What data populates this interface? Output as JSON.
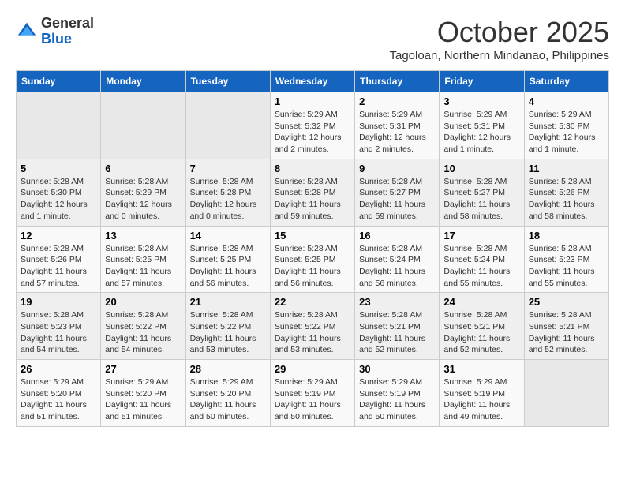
{
  "logo": {
    "general": "General",
    "blue": "Blue"
  },
  "title": "October 2025",
  "location": "Tagoloan, Northern Mindanao, Philippines",
  "headers": [
    "Sunday",
    "Monday",
    "Tuesday",
    "Wednesday",
    "Thursday",
    "Friday",
    "Saturday"
  ],
  "weeks": [
    [
      {
        "day": "",
        "info": ""
      },
      {
        "day": "",
        "info": ""
      },
      {
        "day": "",
        "info": ""
      },
      {
        "day": "1",
        "info": "Sunrise: 5:29 AM\nSunset: 5:32 PM\nDaylight: 12 hours\nand 2 minutes."
      },
      {
        "day": "2",
        "info": "Sunrise: 5:29 AM\nSunset: 5:31 PM\nDaylight: 12 hours\nand 2 minutes."
      },
      {
        "day": "3",
        "info": "Sunrise: 5:29 AM\nSunset: 5:31 PM\nDaylight: 12 hours\nand 1 minute."
      },
      {
        "day": "4",
        "info": "Sunrise: 5:29 AM\nSunset: 5:30 PM\nDaylight: 12 hours\nand 1 minute."
      }
    ],
    [
      {
        "day": "5",
        "info": "Sunrise: 5:28 AM\nSunset: 5:30 PM\nDaylight: 12 hours\nand 1 minute."
      },
      {
        "day": "6",
        "info": "Sunrise: 5:28 AM\nSunset: 5:29 PM\nDaylight: 12 hours\nand 0 minutes."
      },
      {
        "day": "7",
        "info": "Sunrise: 5:28 AM\nSunset: 5:28 PM\nDaylight: 12 hours\nand 0 minutes."
      },
      {
        "day": "8",
        "info": "Sunrise: 5:28 AM\nSunset: 5:28 PM\nDaylight: 11 hours\nand 59 minutes."
      },
      {
        "day": "9",
        "info": "Sunrise: 5:28 AM\nSunset: 5:27 PM\nDaylight: 11 hours\nand 59 minutes."
      },
      {
        "day": "10",
        "info": "Sunrise: 5:28 AM\nSunset: 5:27 PM\nDaylight: 11 hours\nand 58 minutes."
      },
      {
        "day": "11",
        "info": "Sunrise: 5:28 AM\nSunset: 5:26 PM\nDaylight: 11 hours\nand 58 minutes."
      }
    ],
    [
      {
        "day": "12",
        "info": "Sunrise: 5:28 AM\nSunset: 5:26 PM\nDaylight: 11 hours\nand 57 minutes."
      },
      {
        "day": "13",
        "info": "Sunrise: 5:28 AM\nSunset: 5:25 PM\nDaylight: 11 hours\nand 57 minutes."
      },
      {
        "day": "14",
        "info": "Sunrise: 5:28 AM\nSunset: 5:25 PM\nDaylight: 11 hours\nand 56 minutes."
      },
      {
        "day": "15",
        "info": "Sunrise: 5:28 AM\nSunset: 5:25 PM\nDaylight: 11 hours\nand 56 minutes."
      },
      {
        "day": "16",
        "info": "Sunrise: 5:28 AM\nSunset: 5:24 PM\nDaylight: 11 hours\nand 56 minutes."
      },
      {
        "day": "17",
        "info": "Sunrise: 5:28 AM\nSunset: 5:24 PM\nDaylight: 11 hours\nand 55 minutes."
      },
      {
        "day": "18",
        "info": "Sunrise: 5:28 AM\nSunset: 5:23 PM\nDaylight: 11 hours\nand 55 minutes."
      }
    ],
    [
      {
        "day": "19",
        "info": "Sunrise: 5:28 AM\nSunset: 5:23 PM\nDaylight: 11 hours\nand 54 minutes."
      },
      {
        "day": "20",
        "info": "Sunrise: 5:28 AM\nSunset: 5:22 PM\nDaylight: 11 hours\nand 54 minutes."
      },
      {
        "day": "21",
        "info": "Sunrise: 5:28 AM\nSunset: 5:22 PM\nDaylight: 11 hours\nand 53 minutes."
      },
      {
        "day": "22",
        "info": "Sunrise: 5:28 AM\nSunset: 5:22 PM\nDaylight: 11 hours\nand 53 minutes."
      },
      {
        "day": "23",
        "info": "Sunrise: 5:28 AM\nSunset: 5:21 PM\nDaylight: 11 hours\nand 52 minutes."
      },
      {
        "day": "24",
        "info": "Sunrise: 5:28 AM\nSunset: 5:21 PM\nDaylight: 11 hours\nand 52 minutes."
      },
      {
        "day": "25",
        "info": "Sunrise: 5:28 AM\nSunset: 5:21 PM\nDaylight: 11 hours\nand 52 minutes."
      }
    ],
    [
      {
        "day": "26",
        "info": "Sunrise: 5:29 AM\nSunset: 5:20 PM\nDaylight: 11 hours\nand 51 minutes."
      },
      {
        "day": "27",
        "info": "Sunrise: 5:29 AM\nSunset: 5:20 PM\nDaylight: 11 hours\nand 51 minutes."
      },
      {
        "day": "28",
        "info": "Sunrise: 5:29 AM\nSunset: 5:20 PM\nDaylight: 11 hours\nand 50 minutes."
      },
      {
        "day": "29",
        "info": "Sunrise: 5:29 AM\nSunset: 5:19 PM\nDaylight: 11 hours\nand 50 minutes."
      },
      {
        "day": "30",
        "info": "Sunrise: 5:29 AM\nSunset: 5:19 PM\nDaylight: 11 hours\nand 50 minutes."
      },
      {
        "day": "31",
        "info": "Sunrise: 5:29 AM\nSunset: 5:19 PM\nDaylight: 11 hours\nand 49 minutes."
      },
      {
        "day": "",
        "info": ""
      }
    ]
  ]
}
